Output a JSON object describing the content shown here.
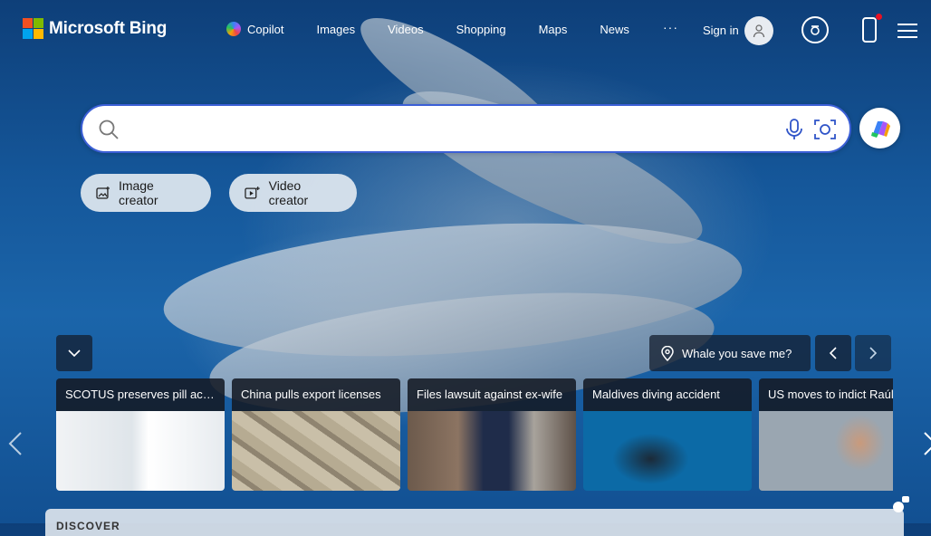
{
  "brand": {
    "name": "Microsoft Bing",
    "logo_colors": [
      "#f25022",
      "#7fba00",
      "#00a4ef",
      "#ffb900"
    ]
  },
  "nav": {
    "items": [
      {
        "label": "Copilot"
      },
      {
        "label": "Images"
      },
      {
        "label": "Videos"
      },
      {
        "label": "Shopping"
      },
      {
        "label": "Maps"
      },
      {
        "label": "News"
      }
    ],
    "more_label": "···"
  },
  "account": {
    "sign_in_label": "Sign in"
  },
  "icons": {
    "rewards": "rewards-icon",
    "phone": "phone-icon",
    "menu": "hamburger-menu-icon",
    "search": "search-icon",
    "mic": "microphone-icon",
    "visual_search": "visual-search-icon",
    "copilot": "copilot-icon"
  },
  "search": {
    "value": "",
    "placeholder": ""
  },
  "creators": [
    {
      "label": "Image creator"
    },
    {
      "label": "Video creator"
    }
  ],
  "image_of_day": {
    "caption": "Whale you save me?"
  },
  "news_cards": [
    {
      "title": "SCOTUS preserves pill access",
      "accent": "#e9edf0"
    },
    {
      "title": "China pulls export licenses",
      "accent": "#a69c86"
    },
    {
      "title": "Files lawsuit against ex-wife",
      "accent": "#5b6470"
    },
    {
      "title": "Maldives diving accident",
      "accent": "#0e5f9c"
    },
    {
      "title": "US moves to indict Raúl Castro",
      "accent": "#b9c4cf"
    }
  ],
  "discover": {
    "label": "DISCOVER"
  }
}
